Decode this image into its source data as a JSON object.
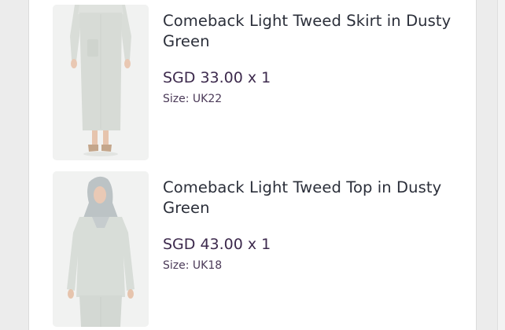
{
  "cart": {
    "items": [
      {
        "title": "Comeback Light Tweed Skirt in Dusty Green",
        "price": "SGD 33.00 x 1",
        "size": "Size: UK22",
        "image_icon": "skirt-product-photo"
      },
      {
        "title": "Comeback Light Tweed Top in Dusty Green",
        "price": "SGD 43.00 x 1",
        "size": "Size: UK18",
        "image_icon": "top-product-photo"
      }
    ]
  },
  "colors": {
    "title": "#2b2f3a",
    "price": "#3d2a4d",
    "garment": "#d7dbd6",
    "thumb_bg": "#f1f2f1"
  }
}
